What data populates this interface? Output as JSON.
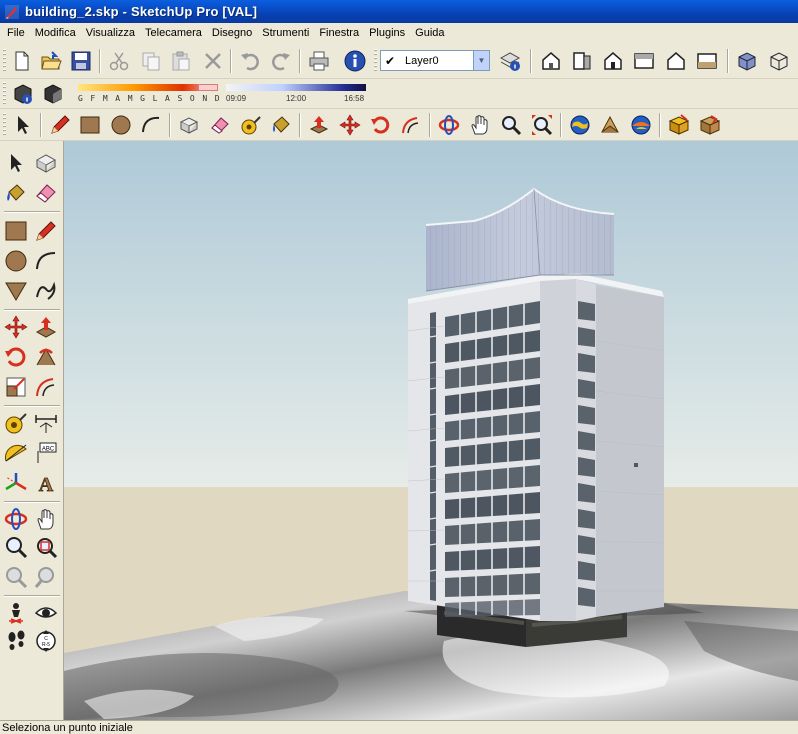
{
  "window": {
    "title": "building_2.skp - SketchUp Pro [VAL]"
  },
  "menu": [
    {
      "id": "file",
      "label": "File"
    },
    {
      "id": "modifica",
      "label": "Modifica"
    },
    {
      "id": "visualizza",
      "label": "Visualizza"
    },
    {
      "id": "telecamera",
      "label": "Telecamera"
    },
    {
      "id": "disegno",
      "label": "Disegno"
    },
    {
      "id": "strumenti",
      "label": "Strumenti"
    },
    {
      "id": "finestra",
      "label": "Finestra"
    },
    {
      "id": "plugins",
      "label": "Plugins"
    },
    {
      "id": "guida",
      "label": "Guida"
    }
  ],
  "layers": {
    "current": "Layer0"
  },
  "shadows": {
    "months_label": "G F M A M G L A S O N D",
    "time_start": "09:09",
    "time_mid": "12:00",
    "time_end": "16:58"
  },
  "status": {
    "text": "Seleziona un punto iniziale"
  },
  "icons": {
    "row1": [
      "new-file-icon",
      "open-file-icon",
      "save-icon",
      "cut-icon",
      "copy-icon",
      "paste-icon",
      "delete-icon",
      "undo-icon",
      "redo-icon",
      "print-icon",
      "model-info-icon"
    ],
    "row1_views": [
      "layer-manager-icon",
      "iso-view-icon",
      "front-view-icon",
      "top-view-icon",
      "right-view-icon",
      "back-view-icon",
      "left-view-icon",
      "xray-icon",
      "wireframe-icon"
    ]
  },
  "colors": {
    "titlebar": "#0a5fe0",
    "sky_top": "#aec9d8",
    "ground": "#e0d8c0"
  }
}
